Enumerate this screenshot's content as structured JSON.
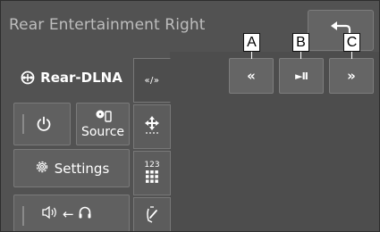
{
  "screen": {
    "title": "Rear Entertainment Right"
  },
  "header": {
    "back_icon": "return-arrow-icon"
  },
  "source_bar": {
    "label": "Rear-DLNA",
    "icon": "dlna-network-icon"
  },
  "buttons": {
    "power_icon": "power-icon",
    "source_label": "Source",
    "source_icon": "source-device-icon",
    "settings_label": "Settings",
    "settings_icon": "gear-icon",
    "audio_icon": "speaker-to-headphones-icon",
    "audio_arrow": "←"
  },
  "tabs": [
    {
      "label": "«/»",
      "icon": "skip-controls-icon",
      "active": true
    },
    {
      "label": "",
      "icon": "cursor-move-icon",
      "active": false
    },
    {
      "label": "123",
      "icon": "number-pad-icon",
      "active": false
    },
    {
      "label": "",
      "icon": "touch-gesture-icon",
      "active": false
    }
  ],
  "controls": [
    {
      "label": "«",
      "icon": "previous-icon"
    },
    {
      "label": "►II",
      "icon": "play-pause-icon"
    },
    {
      "label": "»",
      "icon": "next-icon"
    }
  ],
  "callouts": [
    "A",
    "B",
    "C"
  ],
  "colors": {
    "background": "#525252",
    "panel": "#4d4d4d",
    "button": "#606060",
    "text": "#ffffff",
    "title_text": "#bdbdbd"
  }
}
